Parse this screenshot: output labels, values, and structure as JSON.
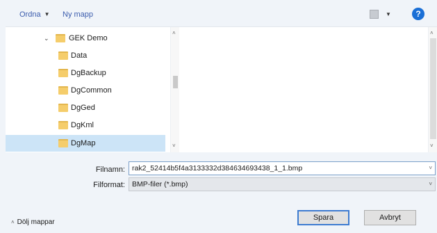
{
  "toolbar": {
    "organize_label": "Ordna",
    "organize_caret": "▼",
    "new_folder_label": "Ny mapp",
    "view_caret": "▼",
    "help_glyph": "?"
  },
  "tree": {
    "expand_glyph": "⌄",
    "items": [
      {
        "label": "GEK Demo",
        "icon": "folder-icon",
        "expanded": true,
        "selected": false
      },
      {
        "label": "Data",
        "icon": "folder-icon",
        "selected": false
      },
      {
        "label": "DgBackup",
        "icon": "folder-icon",
        "selected": false
      },
      {
        "label": "DgCommon",
        "icon": "folder-icon",
        "selected": false
      },
      {
        "label": "DgGed",
        "icon": "folder-icon",
        "selected": false
      },
      {
        "label": "DgKml",
        "icon": "folder-icon",
        "selected": false
      },
      {
        "label": "DgMap",
        "icon": "folder-icon",
        "selected": true
      }
    ]
  },
  "scroll": {
    "up": "˄",
    "down": "˅"
  },
  "fields": {
    "filename_label": "Filnamn:",
    "filename_value": "rak2_52414b5f4a3133332d384634693438_1_1.bmp",
    "filetype_label": "Filformat:",
    "filetype_value": "BMP-filer (*.bmp)",
    "dropdown_glyph": "˅"
  },
  "footer": {
    "hide_folders_label": "Dölj mappar",
    "hide_folders_arrow": "˄",
    "save_label": "Spara",
    "cancel_label": "Avbryt"
  },
  "colors": {
    "accent": "#1a6fd6",
    "selection": "#cce4f7",
    "folder": "#f5cd6b"
  }
}
